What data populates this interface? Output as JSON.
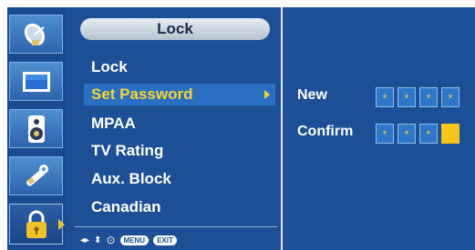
{
  "sidebar": {
    "icons": [
      {
        "name": "satellite-dish-icon",
        "selected": false
      },
      {
        "name": "picture-screen-icon",
        "selected": false
      },
      {
        "name": "speaker-icon",
        "selected": false
      },
      {
        "name": "wrench-tools-icon",
        "selected": false
      },
      {
        "name": "padlock-icon",
        "selected": true
      }
    ]
  },
  "menu": {
    "title": "Lock",
    "items": [
      {
        "label": "Lock"
      },
      {
        "label": "Set Password",
        "highlighted": true
      },
      {
        "label": "MPAA"
      },
      {
        "label": "TV Rating"
      },
      {
        "label": "Aux. Block"
      },
      {
        "label": "Canadian"
      }
    ]
  },
  "footer": {
    "nav_lr": "◂▸",
    "nav_ud": "⬍",
    "ok_symbol": "⊙",
    "menu_label": "MENU",
    "exit_label": "EXIT"
  },
  "password": {
    "new_label": "New",
    "confirm_label": "Confirm",
    "mask_char": "*",
    "new_digits_entered": 4,
    "confirm_digits_entered": 3
  },
  "colors": {
    "panel": "#1d4f97",
    "highlight_bar": "#2b6fc2",
    "highlight_text": "#f5d531",
    "cursor": "#f5c51a"
  }
}
